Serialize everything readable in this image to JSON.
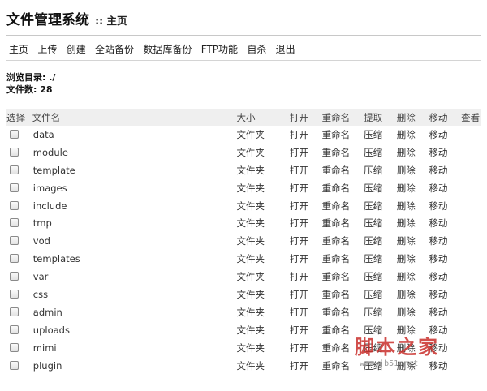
{
  "header": {
    "title": "文件管理系统",
    "subtitle": ":: 主页"
  },
  "nav": [
    "主页",
    "上传",
    "创建",
    "全站备份",
    "数据库备份",
    "FTP功能",
    "自杀",
    "退出"
  ],
  "info": {
    "browse_dir": "浏览目录: ./",
    "file_count": "文件数: 28"
  },
  "table": {
    "headers": [
      "选择",
      "文件名",
      "大小",
      "打开",
      "重命名",
      "提取",
      "删除",
      "移动",
      "查看"
    ],
    "rows": [
      {
        "name": "data",
        "size": "文件夹",
        "open": "打开",
        "rename": "重命名",
        "extract": "压缩",
        "delete": "删除",
        "move": "移动"
      },
      {
        "name": "module",
        "size": "文件夹",
        "open": "打开",
        "rename": "重命名",
        "extract": "压缩",
        "delete": "删除",
        "move": "移动"
      },
      {
        "name": "template",
        "size": "文件夹",
        "open": "打开",
        "rename": "重命名",
        "extract": "压缩",
        "delete": "删除",
        "move": "移动"
      },
      {
        "name": "images",
        "size": "文件夹",
        "open": "打开",
        "rename": "重命名",
        "extract": "压缩",
        "delete": "删除",
        "move": "移动"
      },
      {
        "name": "include",
        "size": "文件夹",
        "open": "打开",
        "rename": "重命名",
        "extract": "压缩",
        "delete": "删除",
        "move": "移动"
      },
      {
        "name": "tmp",
        "size": "文件夹",
        "open": "打开",
        "rename": "重命名",
        "extract": "压缩",
        "delete": "删除",
        "move": "移动"
      },
      {
        "name": "vod",
        "size": "文件夹",
        "open": "打开",
        "rename": "重命名",
        "extract": "压缩",
        "delete": "删除",
        "move": "移动"
      },
      {
        "name": "templates",
        "size": "文件夹",
        "open": "打开",
        "rename": "重命名",
        "extract": "压缩",
        "delete": "删除",
        "move": "移动"
      },
      {
        "name": "var",
        "size": "文件夹",
        "open": "打开",
        "rename": "重命名",
        "extract": "压缩",
        "delete": "删除",
        "move": "移动"
      },
      {
        "name": "css",
        "size": "文件夹",
        "open": "打开",
        "rename": "重命名",
        "extract": "压缩",
        "delete": "删除",
        "move": "移动"
      },
      {
        "name": "admin",
        "size": "文件夹",
        "open": "打开",
        "rename": "重命名",
        "extract": "压缩",
        "delete": "删除",
        "move": "移动"
      },
      {
        "name": "uploads",
        "size": "文件夹",
        "open": "打开",
        "rename": "重命名",
        "extract": "压缩",
        "delete": "删除",
        "move": "移动"
      },
      {
        "name": "mimi",
        "size": "文件夹",
        "open": "打开",
        "rename": "重命名",
        "extract": "压缩",
        "delete": "删除",
        "move": "移动"
      },
      {
        "name": "plugin",
        "size": "文件夹",
        "open": "打开",
        "rename": "重命名",
        "extract": "压缩",
        "delete": "删除",
        "move": "移动"
      }
    ]
  },
  "watermark": {
    "text": "脚本之家",
    "url": "www.jb51.net"
  }
}
